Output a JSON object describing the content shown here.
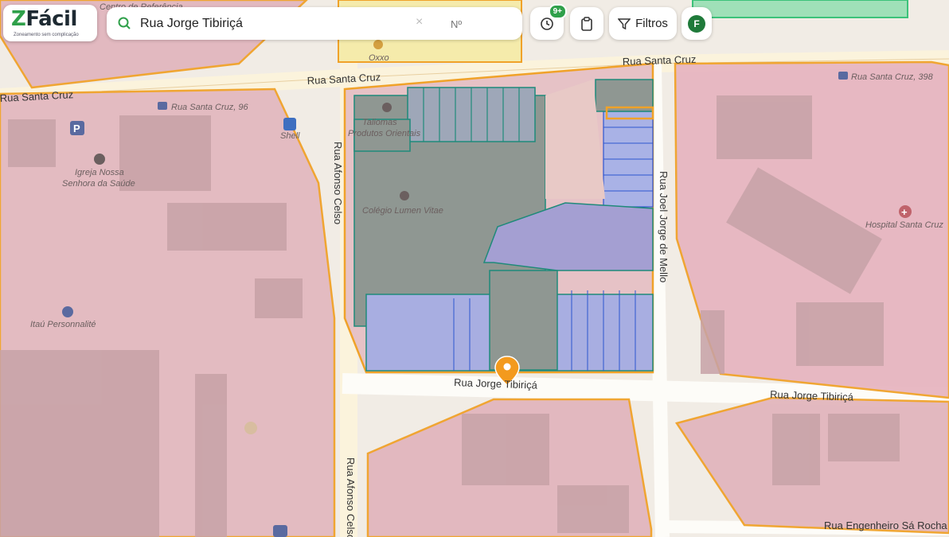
{
  "app": {
    "logo_text": "Fácil",
    "logo_letter": "Z",
    "logo_tagline": "Zoneamento sem complicação"
  },
  "search": {
    "value": "Rua Jorge Tibiriçá",
    "number_placeholder": "Nº",
    "clear_symbol": "×"
  },
  "toolbar": {
    "history_badge": "9+",
    "filters_label": "Filtros",
    "profile_initial": "F"
  },
  "map": {
    "streets": {
      "santa_cruz_top": "Rua Santa Cruz",
      "santa_cruz_mid": "Rua Santa Cruz",
      "santa_cruz_left": "Rua Santa Cruz",
      "afonso_celso_top": "Rua Afonso Celso",
      "afonso_celso_bottom": "Rua Afonso Celso",
      "joel_jorge": "Rua Joel Jorge de Mello",
      "jorge_tibirica_center": "Rua Jorge Tibiriçá",
      "jorge_tibirica_right": "Rua Jorge Tibiriçá",
      "engenheiro": "Rua Engenheiro Sá Rocha"
    },
    "pois": {
      "santa_cruz_96": "Rua Santa Cruz, 96",
      "santa_cruz_398": "Rua Santa Cruz, 398",
      "shell": "Shell",
      "igreja_line1": "Igreja Nossa",
      "igreja_line2": "Senhora da Saúde",
      "colegio": "Colégio Lumen Vitae",
      "taliomas_line1": "Taliomas",
      "taliomas_line2": "Produtos Orientais",
      "itau": "Itaú Personnalité",
      "hospital": "Hospital Santa Cruz",
      "oxxo": "Oxxo",
      "centro_ref": "Centro de Referência"
    },
    "colors": {
      "zone_pink": "#e3b4bd",
      "zone_border": "#f0a229",
      "lot_gray": "#8e9690",
      "lot_blue": "#a9b2e6",
      "lot_border": "#1f8a7a",
      "pin": "#f39a1e"
    }
  }
}
